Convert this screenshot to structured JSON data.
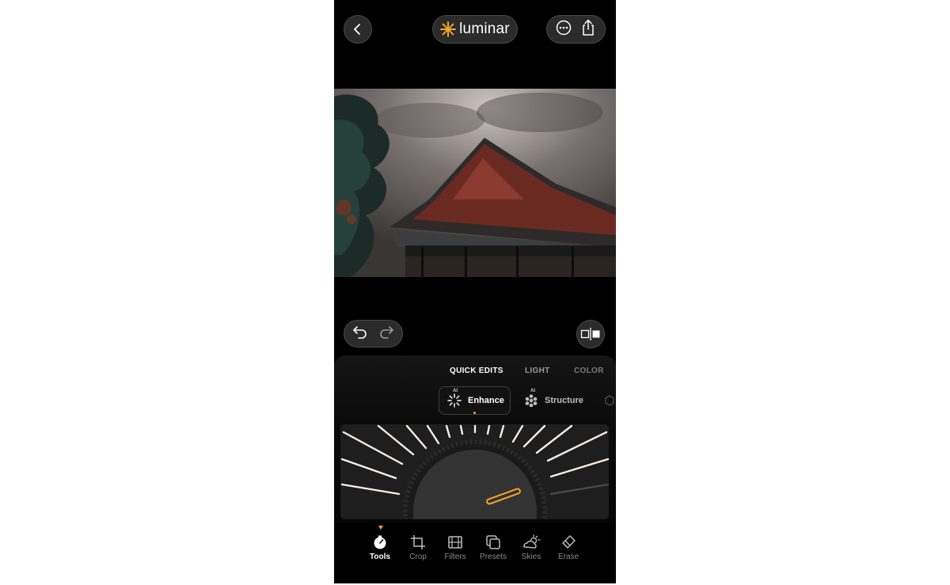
{
  "app": {
    "logo_text": "luminar",
    "accent_color": "#f5a623"
  },
  "header": {
    "back_icon": "chevron-left-icon",
    "more_icon": "ellipsis-circle-icon",
    "share_icon": "share-icon"
  },
  "history": {
    "undo_icon": "undo-icon",
    "redo_icon": "redo-icon",
    "compare_icon": "compare-icon"
  },
  "panel": {
    "tabs": [
      {
        "label": "QUICK EDITS",
        "active": true
      },
      {
        "label": "LIGHT",
        "active": false
      },
      {
        "label": "COLOR",
        "active": false
      }
    ],
    "tools": [
      {
        "label": "Enhance",
        "ai_badge": "AI",
        "active": true
      },
      {
        "label": "Structure",
        "ai_badge": "AI",
        "active": false
      }
    ]
  },
  "nav": [
    {
      "label": "Tools",
      "icon": "tools-icon",
      "active": true
    },
    {
      "label": "Crop",
      "icon": "crop-icon",
      "active": false
    },
    {
      "label": "Filters",
      "icon": "film-icon",
      "active": false
    },
    {
      "label": "Presets",
      "icon": "presets-icon",
      "active": false
    },
    {
      "label": "Skies",
      "icon": "sky-icon",
      "active": false
    },
    {
      "label": "Erase",
      "icon": "eraser-icon",
      "active": false
    }
  ]
}
